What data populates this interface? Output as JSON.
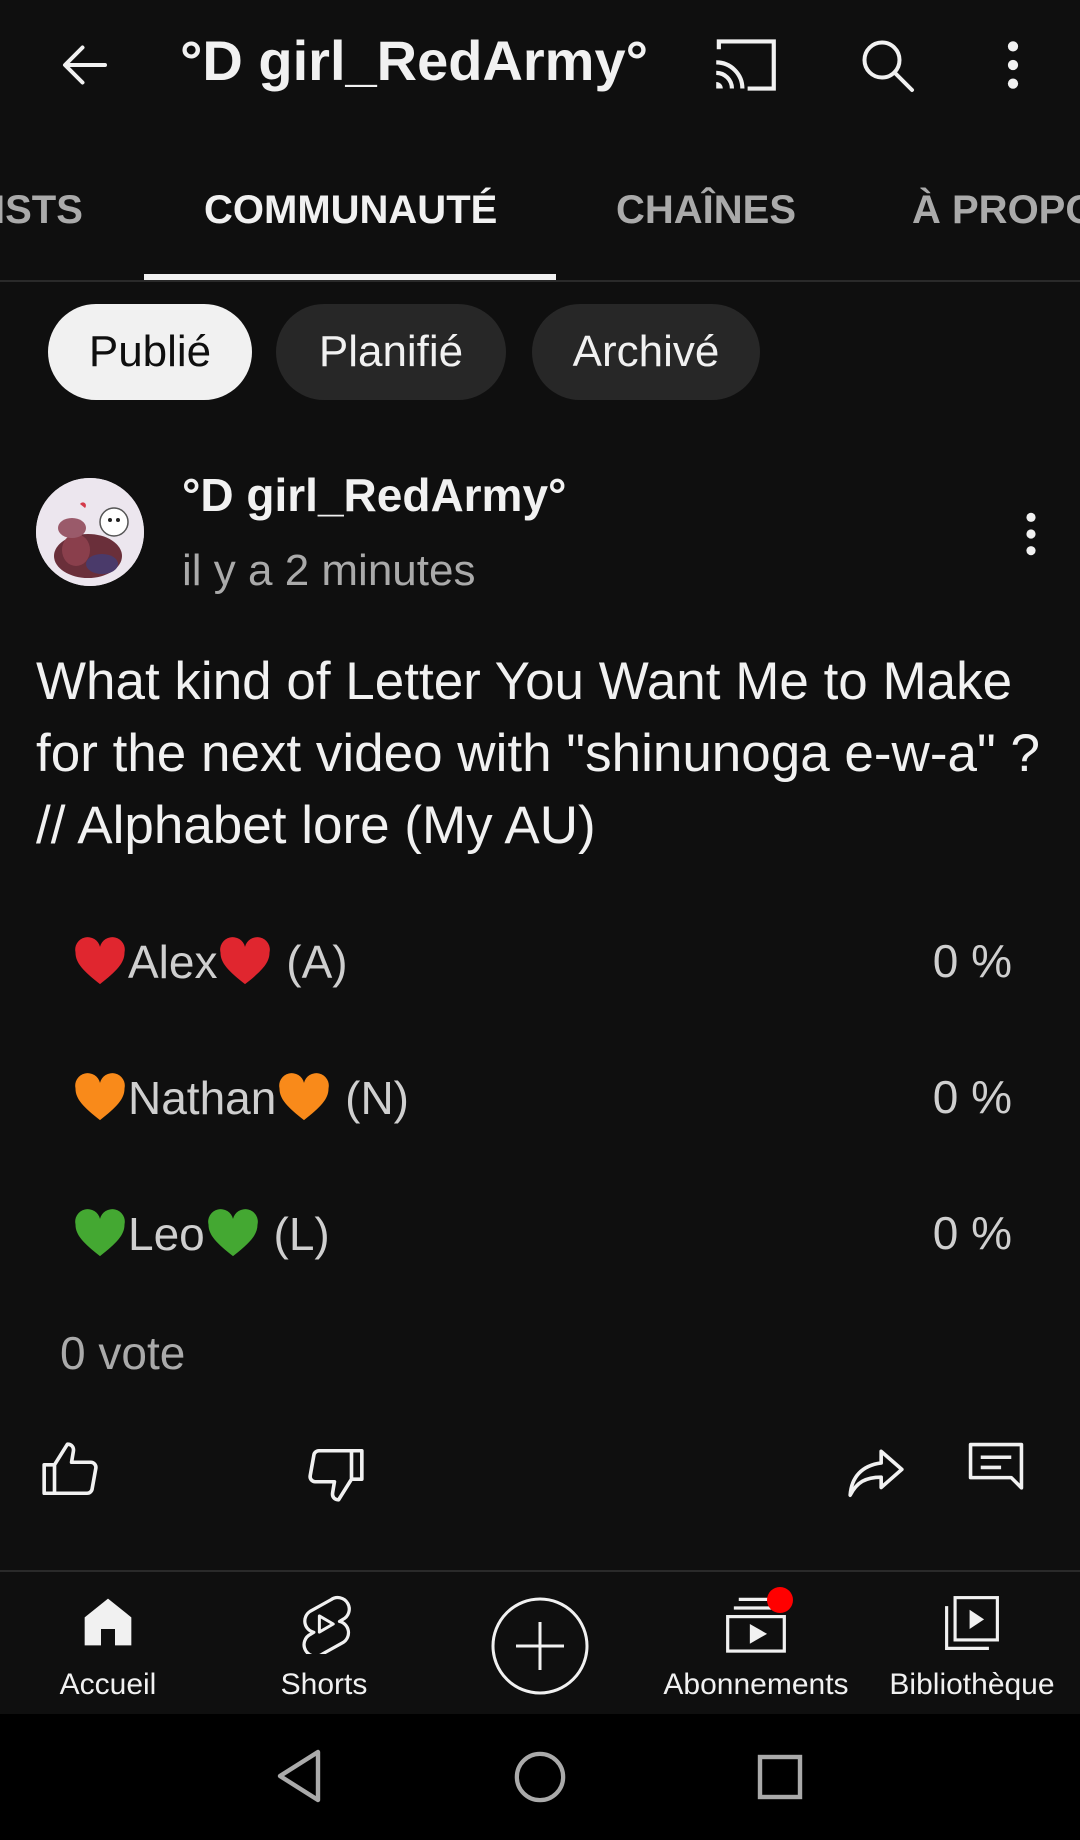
{
  "header": {
    "title": "°D girl_RedArmy°",
    "icons": [
      "back-arrow-icon",
      "cast-icon",
      "search-icon",
      "more-vert-icon"
    ]
  },
  "tabs": [
    {
      "label": "ISTS"
    },
    {
      "label": "COMMUNAUTÉ",
      "active": true
    },
    {
      "label": "CHAÎNES"
    },
    {
      "label": "À PROPO"
    }
  ],
  "filters": [
    {
      "label": "Publié",
      "selected": true
    },
    {
      "label": "Planifié"
    },
    {
      "label": "Archivé"
    }
  ],
  "post": {
    "author": "°D girl_RedArmy°",
    "time": "il y a 2 minutes",
    "text": "What kind of Letter You Want Me to Make for the next video with \"shinunoga e-w-a\" ? // Alphabet lore (My AU)",
    "poll": {
      "options": [
        {
          "name": "Alex",
          "suffix": " (A)",
          "percent": "0 %",
          "heart_color": "#e0262f"
        },
        {
          "name": "Nathan",
          "suffix": " (N)",
          "percent": "0 %",
          "heart_color": "#f98a1a"
        },
        {
          "name": "Leo",
          "suffix": " (L)",
          "percent": "0 %",
          "heart_color": "#44a832"
        }
      ],
      "votes": "0 vote"
    },
    "actions": [
      "like-icon",
      "dislike-icon",
      "share-icon",
      "comment-icon"
    ]
  },
  "bottom_nav": [
    {
      "label": "Accueil",
      "icon": "home-icon"
    },
    {
      "label": "Shorts",
      "icon": "shorts-icon"
    },
    {
      "label": "",
      "icon": "create-icon"
    },
    {
      "label": "Abonnements",
      "icon": "subscriptions-icon",
      "badge": true
    },
    {
      "label": "Bibliothèque",
      "icon": "library-icon"
    }
  ],
  "colors": {
    "background": "#0f0f0f",
    "text": "#f1f1f1",
    "secondary_text": "#aaaaaa",
    "chip_bg": "#272727",
    "badge": "#ff0000"
  }
}
